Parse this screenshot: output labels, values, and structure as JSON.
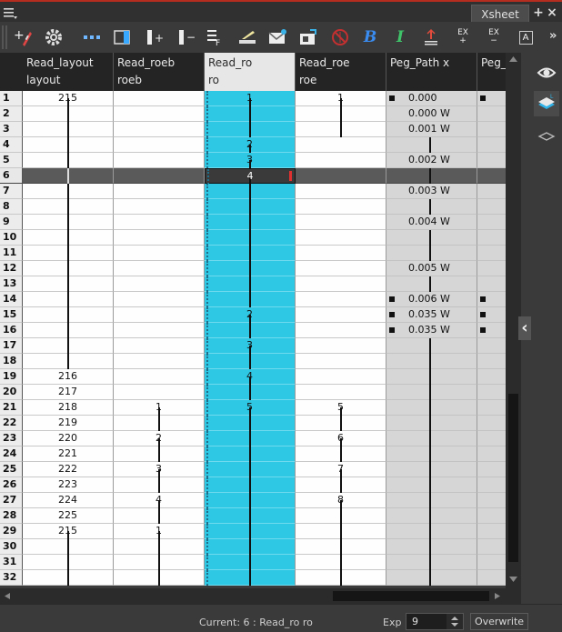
{
  "window": {
    "tab_label": "Xsheet",
    "plus_icon": "+",
    "close_icon": "×"
  },
  "toolbar": {
    "items": [
      {
        "name": "add-drawing-icon"
      },
      {
        "name": "gear-icon"
      },
      {
        "name": "show-inbetween-icon"
      },
      {
        "name": "toggle-column-icon"
      },
      {
        "name": "increase-exposure-icon",
        "text": "+"
      },
      {
        "name": "decrease-exposure-icon",
        "text": "−"
      },
      {
        "name": "insert-blank-icon"
      },
      {
        "name": "scanner-icon"
      },
      {
        "name": "mail-in-icon"
      },
      {
        "name": "mail-out-icon"
      },
      {
        "name": "no-entry-icon"
      },
      {
        "name": "bezier-b-icon",
        "text": "B"
      },
      {
        "name": "italic-i-icon",
        "text": "I"
      },
      {
        "name": "ease-icon"
      },
      {
        "name": "ex-plus-icon",
        "text": "EX\n+"
      },
      {
        "name": "ex-minus-icon",
        "text": "EX\n−"
      },
      {
        "name": "text-a-icon",
        "text": "A"
      }
    ],
    "more": "»"
  },
  "columns": [
    {
      "name": "Read_layout",
      "sub": "layout"
    },
    {
      "name": "Read_roeb",
      "sub": "roeb"
    },
    {
      "name": "Read_ro",
      "sub": "ro"
    },
    {
      "name": "Read_roe",
      "sub": "roe"
    },
    {
      "name": "Peg_Path x",
      "sub": ""
    },
    {
      "name": "Peg_Pat",
      "sub": ""
    }
  ],
  "rows": [
    {
      "n": "1",
      "layout": "215",
      "roeb": "",
      "ro": "1",
      "roe": "1",
      "peg": "0.000"
    },
    {
      "n": "2",
      "layout": "",
      "roeb": "",
      "ro": "",
      "roe": "",
      "peg": "0.000 W"
    },
    {
      "n": "3",
      "layout": "",
      "roeb": "",
      "ro": "",
      "roe": "",
      "peg": "0.001 W"
    },
    {
      "n": "4",
      "layout": "",
      "roeb": "",
      "ro": "2",
      "roe": "",
      "peg": ""
    },
    {
      "n": "5",
      "layout": "",
      "roeb": "",
      "ro": "3",
      "roe": "",
      "peg": "0.002 W"
    },
    {
      "n": "6",
      "layout": "",
      "roeb": "",
      "ro": "4",
      "roe": "",
      "peg": ""
    },
    {
      "n": "7",
      "layout": "",
      "roeb": "",
      "ro": "",
      "roe": "",
      "peg": "0.003 W"
    },
    {
      "n": "8",
      "layout": "",
      "roeb": "",
      "ro": "",
      "roe": "",
      "peg": ""
    },
    {
      "n": "9",
      "layout": "",
      "roeb": "",
      "ro": "",
      "roe": "",
      "peg": "0.004 W"
    },
    {
      "n": "10",
      "layout": "",
      "roeb": "",
      "ro": "",
      "roe": "",
      "peg": ""
    },
    {
      "n": "11",
      "layout": "",
      "roeb": "",
      "ro": "",
      "roe": "",
      "peg": ""
    },
    {
      "n": "12",
      "layout": "",
      "roeb": "",
      "ro": "",
      "roe": "",
      "peg": "0.005 W"
    },
    {
      "n": "13",
      "layout": "",
      "roeb": "",
      "ro": "",
      "roe": "",
      "peg": ""
    },
    {
      "n": "14",
      "layout": "",
      "roeb": "",
      "ro": "",
      "roe": "",
      "peg": "0.006 W"
    },
    {
      "n": "15",
      "layout": "",
      "roeb": "",
      "ro": "2",
      "roe": "",
      "peg": "0.035 W"
    },
    {
      "n": "16",
      "layout": "",
      "roeb": "",
      "ro": "",
      "roe": "",
      "peg": "0.035 W"
    },
    {
      "n": "17",
      "layout": "",
      "roeb": "",
      "ro": "3",
      "roe": "",
      "peg": ""
    },
    {
      "n": "18",
      "layout": "",
      "roeb": "",
      "ro": "",
      "roe": "",
      "peg": ""
    },
    {
      "n": "19",
      "layout": "216",
      "roeb": "",
      "ro": "4",
      "roe": "",
      "peg": ""
    },
    {
      "n": "20",
      "layout": "217",
      "roeb": "",
      "ro": "",
      "roe": "",
      "peg": ""
    },
    {
      "n": "21",
      "layout": "218",
      "roeb": "1",
      "ro": "5",
      "roe": "5",
      "peg": ""
    },
    {
      "n": "22",
      "layout": "219",
      "roeb": "",
      "ro": "",
      "roe": "",
      "peg": ""
    },
    {
      "n": "23",
      "layout": "220",
      "roeb": "2",
      "ro": "",
      "roe": "6",
      "peg": ""
    },
    {
      "n": "24",
      "layout": "221",
      "roeb": "",
      "ro": "",
      "roe": "",
      "peg": ""
    },
    {
      "n": "25",
      "layout": "222",
      "roeb": "3",
      "ro": "",
      "roe": "7",
      "peg": ""
    },
    {
      "n": "26",
      "layout": "223",
      "roeb": "",
      "ro": "",
      "roe": "",
      "peg": ""
    },
    {
      "n": "27",
      "layout": "224",
      "roeb": "4",
      "ro": "",
      "roe": "8",
      "peg": ""
    },
    {
      "n": "28",
      "layout": "225",
      "roeb": "",
      "ro": "",
      "roe": "",
      "peg": ""
    },
    {
      "n": "29",
      "layout": "215",
      "roeb": "1",
      "ro": "",
      "roe": "",
      "peg": ""
    },
    {
      "n": "30",
      "layout": "",
      "roeb": "",
      "ro": "",
      "roe": "",
      "peg": ""
    },
    {
      "n": "31",
      "layout": "",
      "roeb": "",
      "ro": "",
      "roe": "",
      "peg": ""
    },
    {
      "n": "32",
      "layout": "",
      "roeb": "",
      "ro": "",
      "roe": "",
      "peg": ""
    }
  ],
  "selected_row": "6",
  "sidebar": {
    "items": [
      {
        "name": "eye-icon"
      },
      {
        "name": "layers-icon"
      },
      {
        "name": "layer-outline-icon"
      }
    ],
    "collapse_icon": "‹"
  },
  "status": {
    "current": "Current: 6 : Read_ro ro",
    "exp_label": "Exp",
    "exp_value": "9",
    "overwrite": "Overwrite"
  },
  "colors": {
    "accent_cyan": "#2ec8e4",
    "top_red": "#b52d1e",
    "background": "#3a3a3a"
  }
}
